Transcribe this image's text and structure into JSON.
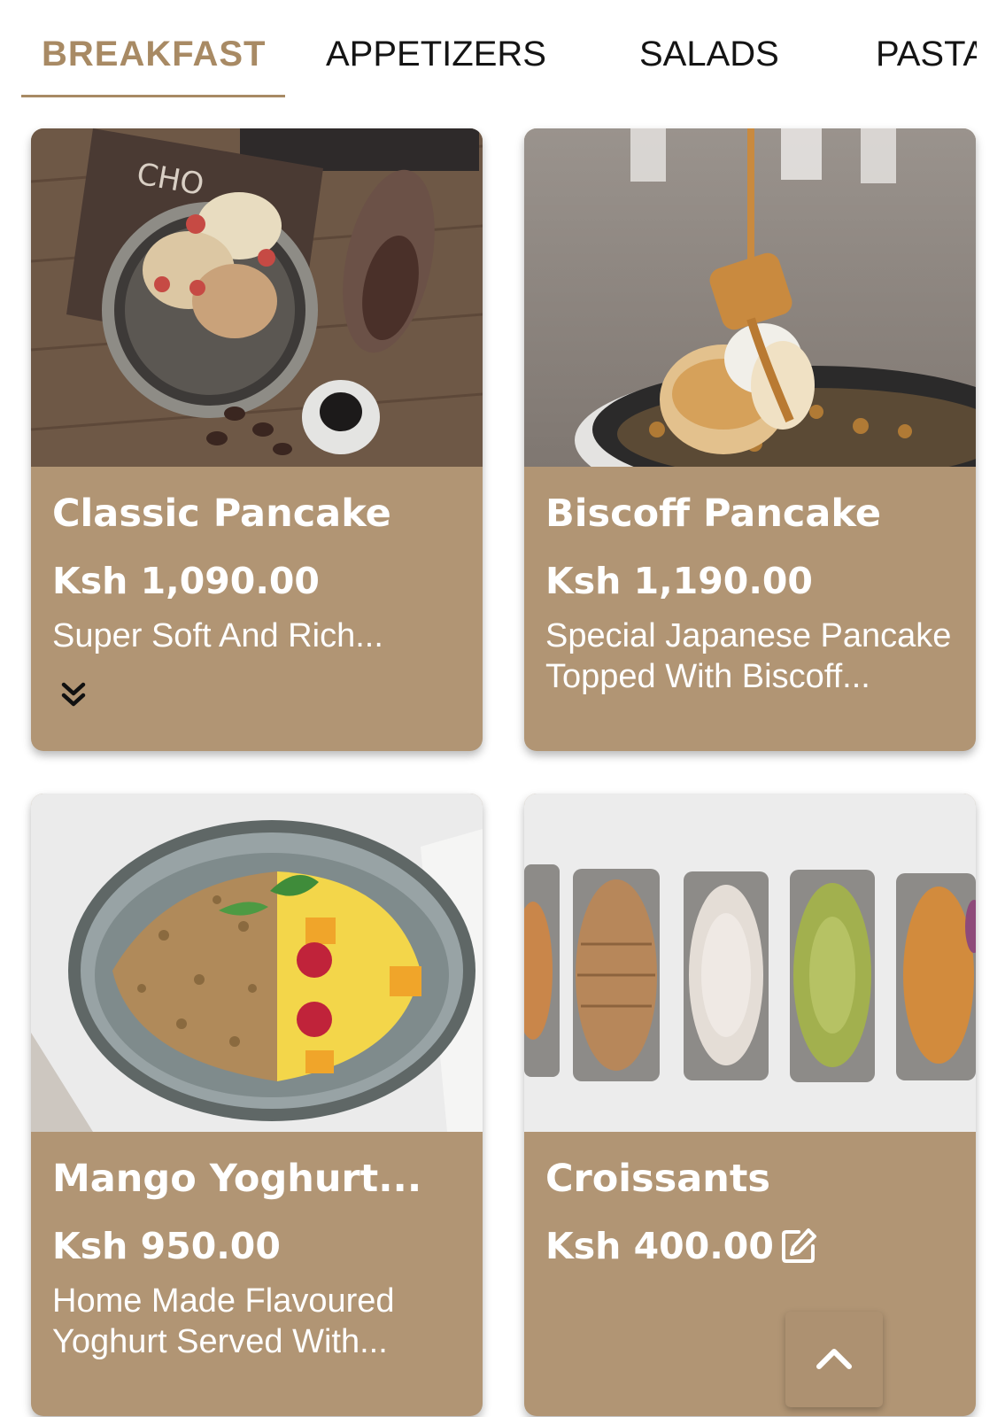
{
  "tabs": [
    {
      "label": "BREAKFAST",
      "active": true
    },
    {
      "label": "APPETIZERS",
      "active": false
    },
    {
      "label": "SALADS",
      "active": false
    },
    {
      "label": "PASTA",
      "active": false
    }
  ],
  "colors": {
    "accent": "#a88a64",
    "card_background": "#b19574",
    "tab_text": "#141414",
    "card_text": "#ffffff"
  },
  "menu_items": [
    {
      "title": "Classic Pancake",
      "price": "Ksh 1,090.00",
      "description": "Super Soft And Rich...",
      "image": "pancake-bowl-photo",
      "icon": "chevron-double-down-icon"
    },
    {
      "title": "Biscoff Pancake",
      "price": "Ksh 1,190.00",
      "description": "Special Japanese Pancake Topped With Biscoff...",
      "image": "biscoff-pancake-photo"
    },
    {
      "title": "Mango Yoghurt...",
      "price": "Ksh 950.00",
      "description": "Home Made Flavoured Yoghurt Served With...",
      "image": "mango-yoghurt-bowl-photo"
    },
    {
      "title": "Croissants",
      "price": "Ksh 400.00",
      "description": "",
      "image": "croissants-photo",
      "icon": "edit-icon"
    }
  ],
  "scroll_top_icon": "chevron-up-icon"
}
